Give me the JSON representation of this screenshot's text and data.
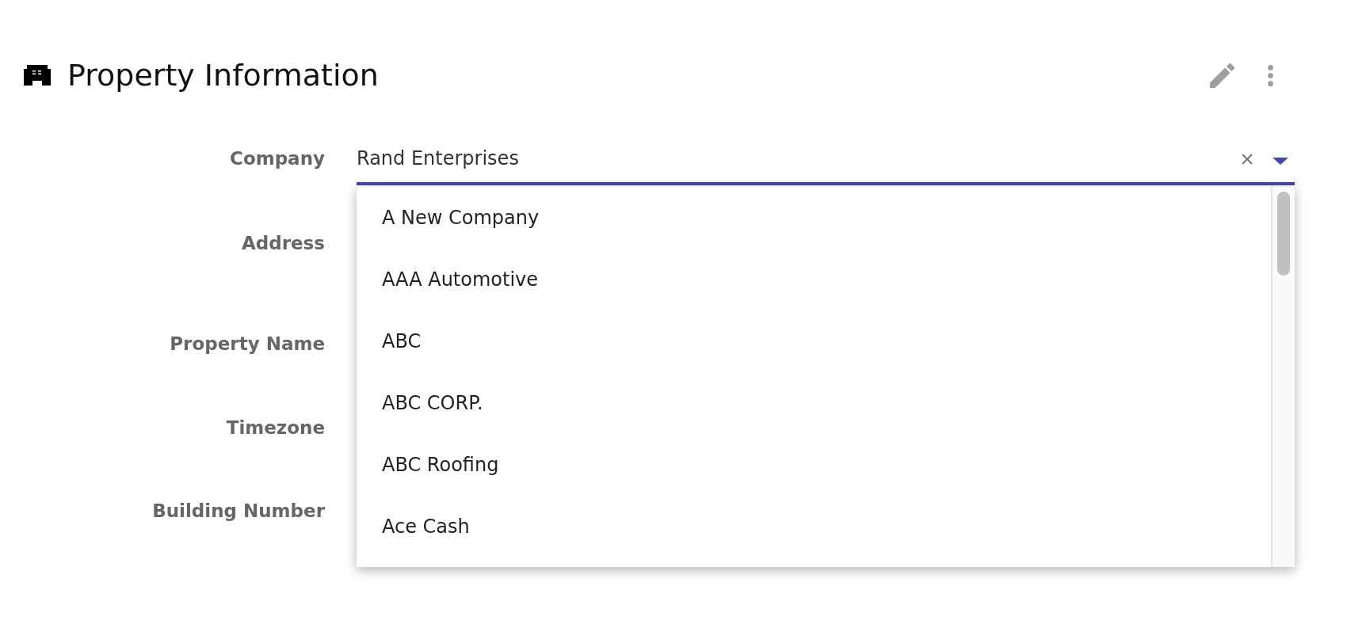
{
  "header": {
    "title": "Property Information"
  },
  "form": {
    "fields": [
      {
        "label": "Company",
        "value": "Rand Enterprises",
        "expanded": true,
        "options": [
          {
            "label": "A New Company",
            "selected": false
          },
          {
            "label": "AAA Automotive",
            "selected": false
          },
          {
            "label": "ABC",
            "selected": false
          },
          {
            "label": "ABC CORP.",
            "selected": false
          },
          {
            "label": "ABC Roofing",
            "selected": false
          },
          {
            "label": "Ace Cash",
            "selected": false
          }
        ]
      },
      {
        "label": "Address"
      },
      {
        "label": "Property Name"
      },
      {
        "label": "Timezone"
      },
      {
        "label": "Building Number"
      }
    ]
  }
}
